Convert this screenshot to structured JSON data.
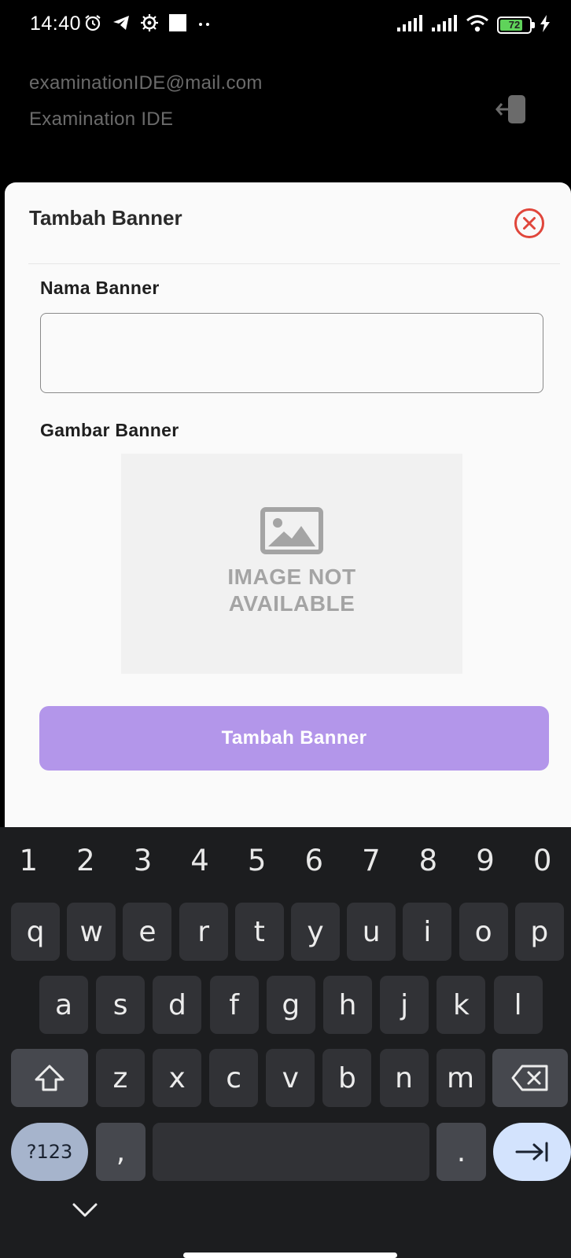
{
  "status_bar": {
    "time": "14:40",
    "battery_level": 72,
    "battery_text": "72",
    "left_icons": [
      "alarm-icon",
      "telegram-icon",
      "settings-icon",
      "square-icon",
      "more-dots-icon"
    ],
    "right_icons": [
      "signal-icon",
      "signal-icon",
      "wifi-icon",
      "battery-icon",
      "charging-icon"
    ]
  },
  "account": {
    "email": "examinationIDE@mail.com",
    "name": "Examination IDE",
    "logout_icon": "logout-icon"
  },
  "sheet": {
    "title": "Tambah Banner",
    "close_icon": "close-icon",
    "name_label": "Nama Banner",
    "name_value": "",
    "image_label": "Gambar Banner",
    "image_placeholder_line1": "IMAGE NOT",
    "image_placeholder_line2": "AVAILABLE",
    "submit_label": "Tambah Banner"
  },
  "colors": {
    "accent_button": "#b396ea",
    "close_red": "#e0463b",
    "keyboard_bg": "#1c1d1f"
  },
  "keyboard": {
    "numbers": [
      "1",
      "2",
      "3",
      "4",
      "5",
      "6",
      "7",
      "8",
      "9",
      "0"
    ],
    "row1": [
      "q",
      "w",
      "e",
      "r",
      "t",
      "y",
      "u",
      "i",
      "o",
      "p"
    ],
    "row2": [
      "a",
      "s",
      "d",
      "f",
      "g",
      "h",
      "j",
      "k",
      "l"
    ],
    "row3": [
      "z",
      "x",
      "c",
      "v",
      "b",
      "n",
      "m"
    ],
    "symbols_label": "?123",
    "comma": ",",
    "period": "."
  }
}
